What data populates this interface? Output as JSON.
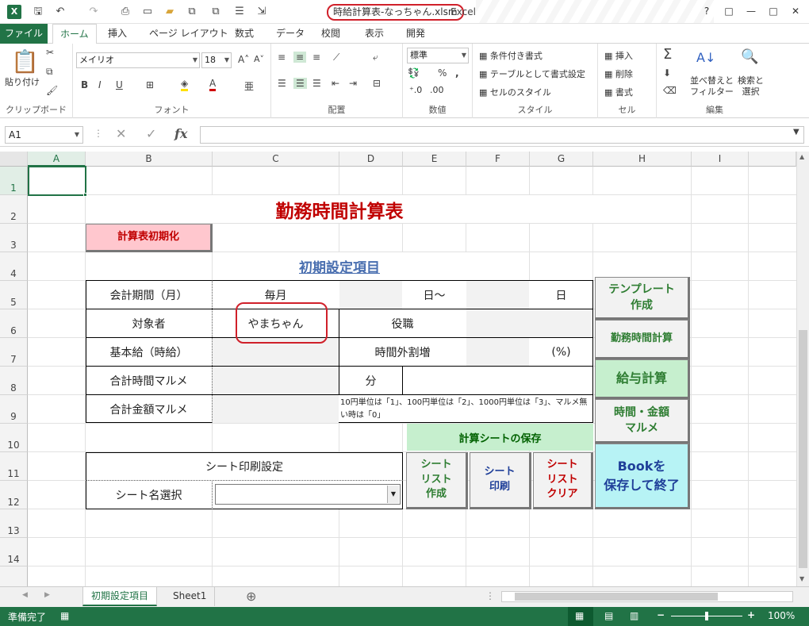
{
  "window": {
    "title": "時給計算表-なっちゃん.xlsm",
    "app": " - Excel",
    "help": "?",
    "restore": "□",
    "min": "—",
    "max": "□",
    "close": "✕"
  },
  "tabs": [
    "ファイル",
    "ホーム",
    "挿入",
    "ページ レイアウト",
    "数式",
    "データ",
    "校閲",
    "表示",
    "開発"
  ],
  "ribbon": {
    "clipboard": {
      "paste": "貼り付け",
      "label": "クリップボード"
    },
    "font": {
      "name": "メイリオ",
      "size": "18",
      "label": "フォント"
    },
    "align": {
      "label": "配置"
    },
    "number": {
      "format": "標準",
      "label": "数値"
    },
    "style": {
      "cond": "条件付き書式",
      "table": "テーブルとして書式設定",
      "cell": "セルのスタイル",
      "label": "スタイル"
    },
    "cells": {
      "insert": "挿入",
      "delete": "削除",
      "format": "書式",
      "label": "セル"
    },
    "edit": {
      "sort": "並べ替えと\nフィルター",
      "find": "検索と\n選択",
      "label": "編集"
    }
  },
  "formula_bar": {
    "name_box": "A1",
    "fx": "fx"
  },
  "columns": [
    "A",
    "B",
    "C",
    "D",
    "E",
    "F",
    "G",
    "H",
    "I"
  ],
  "rows": [
    "1",
    "2",
    "3",
    "4",
    "5",
    "6",
    "7",
    "8",
    "9",
    "10",
    "11",
    "12",
    "13",
    "14"
  ],
  "sheet": {
    "title": "勤務時間計算表",
    "init_button": "計算表初期化",
    "settings_title": "初期設定項目",
    "r5": {
      "label": "会計期間（月）",
      "c": "毎月",
      "e": "日～",
      "g": "日"
    },
    "r6": {
      "label": "対象者",
      "c": "やまちゃん",
      "d": "役職"
    },
    "r7": {
      "label": "基本給（時給）",
      "d": "時間外割増",
      "g": "(%)"
    },
    "r8": {
      "label": "合計時間マルメ",
      "d": "分"
    },
    "r9": {
      "label": "合計金額マルメ",
      "note": "10円単位は「1」、100円単位は「2」、1000円単位は「3」、マルメ無い時は「0」"
    },
    "print_title": "シート印刷設定",
    "sheet_select": "シート名選択",
    "save_sheet": "計算シートの保存",
    "btn_list": "シート\nリスト\n作成",
    "btn_print": "シート\n印刷",
    "btn_clear": "シート\nリスト\nクリア",
    "btn_template": "テンプレート\n作成",
    "btn_calc": "勤務時間計算",
    "btn_pay": "給与計算",
    "btn_round": "時間・金額\nマルメ",
    "btn_book": "Bookを\n保存して終了"
  },
  "sheet_tabs": [
    "初期設定項目",
    "Sheet1"
  ],
  "status": {
    "ready": "準備完了",
    "zoom": "100%"
  }
}
